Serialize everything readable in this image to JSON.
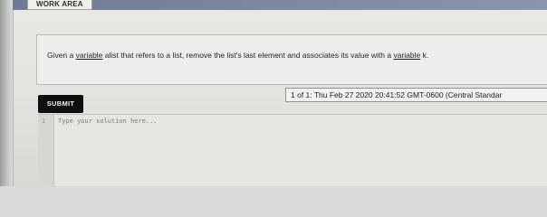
{
  "header": {
    "work_area_label": "WORK AREA"
  },
  "prompt": {
    "text_1": "Given a ",
    "text_var1": "variable",
    "text_2": " alist that refers to a list, remove the list's last element and associates its value with a ",
    "text_var2": "variable",
    "text_3": " k."
  },
  "actions": {
    "submit_label": "SUBMIT"
  },
  "submission": {
    "timestamp": "1 of 1: Thu Feb 27 2020 20:41:52 GMT-0600 (Central Standar"
  },
  "editor": {
    "line_number": "1",
    "placeholder": "Type your solution here..."
  },
  "colors": {
    "top_bar": "#6f7b93",
    "submit_bg": "#0e0f0e",
    "panel_bg": "#e8eae6"
  }
}
